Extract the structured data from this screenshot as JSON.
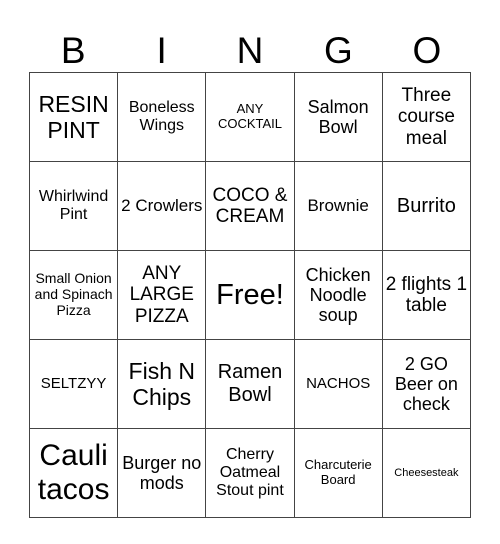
{
  "header": [
    "B",
    "I",
    "N",
    "G",
    "O"
  ],
  "rows": [
    [
      "RESIN PINT",
      "Boneless Wings",
      "ANY COCKTAIL",
      "Salmon Bowl",
      "Three course meal"
    ],
    [
      "Whirlwind Pint",
      "2 Crowlers",
      "COCO & CREAM",
      "Brownie",
      "Burrito"
    ],
    [
      "Small Onion and Spinach Pizza",
      "ANY LARGE PIZZA",
      "Free!",
      "Chicken Noodle soup",
      "2 flights 1 table"
    ],
    [
      "SELTZYY",
      "Fish N Chips",
      "Ramen Bowl",
      "NACHOS",
      "2 GO Beer on check"
    ],
    [
      "Cauli tacos",
      "Burger no mods",
      "Cherry Oatmeal Stout pint",
      "Charcuterie Board",
      "Cheesesteak"
    ]
  ]
}
